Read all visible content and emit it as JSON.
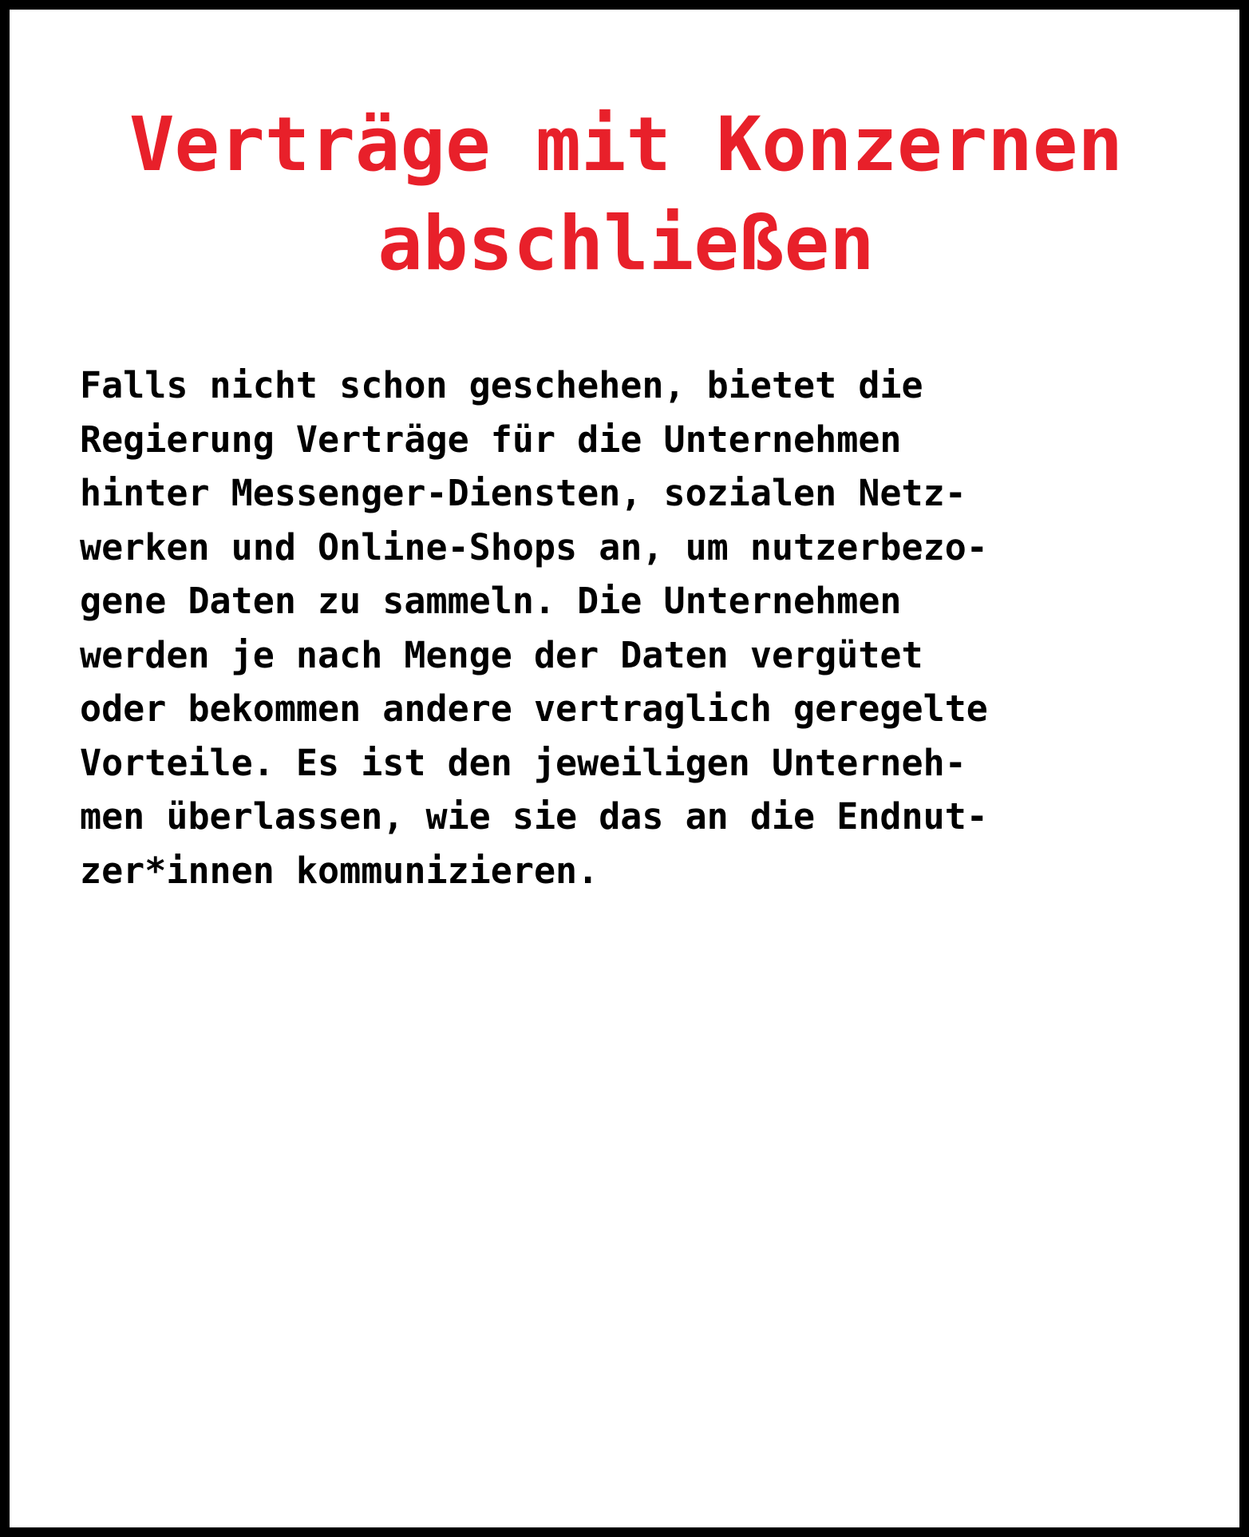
{
  "title": {
    "lines": [
      "Verträge mit Konzernen",
      "abschließen"
    ],
    "color": "#e8202a"
  },
  "body": {
    "lines": [
      "Falls nicht schon geschehen, bietet die",
      "Regierung Verträge für die Unternehmen",
      "hinter Messenger-Diensten, sozialen Netz-",
      "werken und Online-Shops an, um nutzerbezo-",
      "gene Daten zu sammeln. Die Unternehmen",
      "werden je nach Menge der Daten vergütet",
      "oder bekommen andere vertraglich geregelte",
      "Vorteile. Es ist den jeweiligen Unterneh-",
      "men überlassen, wie sie das an die Endnut-",
      "zer*innen kommunizieren."
    ],
    "color": "#000000"
  }
}
